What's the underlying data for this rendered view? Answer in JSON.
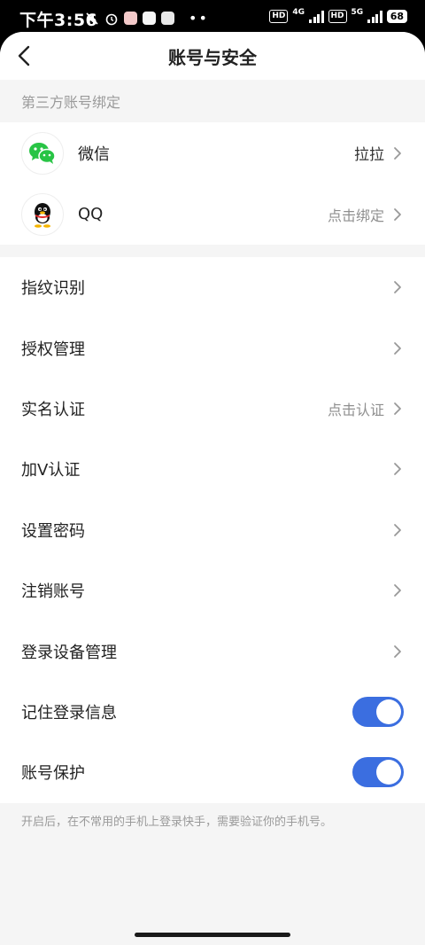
{
  "status_bar": {
    "time": "下午3:56",
    "hd1": "HD",
    "net1": "4G",
    "hd2": "HD",
    "net2": "5G",
    "battery": "68"
  },
  "header": {
    "title": "账号与安全"
  },
  "third_party": {
    "section_title": "第三方账号绑定",
    "items": [
      {
        "label": "微信",
        "value": "拉拉",
        "icon": "wechat-icon"
      },
      {
        "label": "QQ",
        "value": "点击绑定",
        "icon": "qq-icon"
      }
    ]
  },
  "settings": {
    "items": [
      {
        "label": "指纹识别",
        "value": ""
      },
      {
        "label": "授权管理",
        "value": ""
      },
      {
        "label": "实名认证",
        "value": "点击认证"
      },
      {
        "label": "加V认证",
        "value": ""
      },
      {
        "label": "设置密码",
        "value": ""
      },
      {
        "label": "注销账号",
        "value": ""
      },
      {
        "label": "登录设备管理",
        "value": ""
      }
    ],
    "toggles": [
      {
        "label": "记住登录信息",
        "on": true
      },
      {
        "label": "账号保护",
        "on": true
      }
    ],
    "footnote": "开启后，在不常用的手机上登录快手，需要验证你的手机号。"
  },
  "colors": {
    "accent": "#3b6ee0",
    "wechat": "#28c445",
    "background": "#f5f5f5"
  }
}
